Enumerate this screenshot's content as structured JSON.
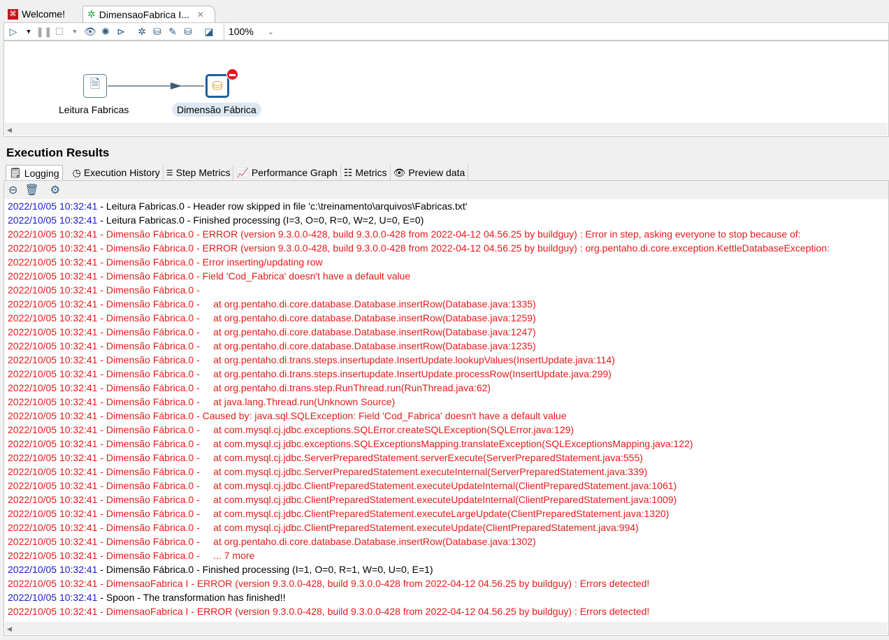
{
  "tabs": [
    {
      "label": "Welcome!",
      "icon": "welcome-icon"
    },
    {
      "label": "DimensaoFabrica I...",
      "icon": "transformation-icon"
    }
  ],
  "toolbar": {
    "zoom": "100%"
  },
  "canvas": {
    "steps": [
      {
        "label": "Leitura Fabricas",
        "icon": "text-file-input-icon"
      },
      {
        "label": "Dimensão Fábrica",
        "icon": "insert-update-icon",
        "error": true
      }
    ]
  },
  "results": {
    "title": "Execution Results",
    "tabs": [
      "Logging",
      "Execution History",
      "Step Metrics",
      "Performance Graph",
      "Metrics",
      "Preview data"
    ]
  },
  "colors": {
    "timestamp": "#1a1acc",
    "error": "#e51a1a"
  },
  "log": [
    {
      "ts": "2022/10/05 10:32:41",
      "msg": " - Leitura Fabricas.0 - Header row skipped in file 'c:\\treinamento\\arquivos\\Fabricas.txt'",
      "level": "info"
    },
    {
      "ts": "2022/10/05 10:32:41",
      "msg": " - Leitura Fabricas.0 - Finished processing (I=3, O=0, R=0, W=2, U=0, E=0)",
      "level": "info"
    },
    {
      "ts": "2022/10/05 10:32:41",
      "msg": " - Dimensão Fábrica.0 - ERROR (version 9.3.0.0-428, build 9.3.0.0-428 from 2022-04-12 04.56.25 by buildguy) : Error in step, asking everyone to stop because of:",
      "level": "error"
    },
    {
      "ts": "2022/10/05 10:32:41",
      "msg": " - Dimensão Fábrica.0 - ERROR (version 9.3.0.0-428, build 9.3.0.0-428 from 2022-04-12 04.56.25 by buildguy) : org.pentaho.di.core.exception.KettleDatabaseException:",
      "level": "error"
    },
    {
      "ts": "2022/10/05 10:32:41",
      "msg": " - Dimensão Fábrica.0 - Error inserting/updating row",
      "level": "error"
    },
    {
      "ts": "2022/10/05 10:32:41",
      "msg": " - Dimensão Fábrica.0 - Field 'Cod_Fabrica' doesn't have a default value",
      "level": "error"
    },
    {
      "ts": "2022/10/05 10:32:41",
      "msg": " - Dimensão Fábrica.0 - ",
      "level": "error"
    },
    {
      "ts": "2022/10/05 10:32:41",
      "msg": " - Dimensão Fábrica.0 -     at org.pentaho.di.core.database.Database.insertRow(Database.java:1335)",
      "level": "error"
    },
    {
      "ts": "2022/10/05 10:32:41",
      "msg": " - Dimensão Fábrica.0 -     at org.pentaho.di.core.database.Database.insertRow(Database.java:1259)",
      "level": "error"
    },
    {
      "ts": "2022/10/05 10:32:41",
      "msg": " - Dimensão Fábrica.0 -     at org.pentaho.di.core.database.Database.insertRow(Database.java:1247)",
      "level": "error"
    },
    {
      "ts": "2022/10/05 10:32:41",
      "msg": " - Dimensão Fábrica.0 -     at org.pentaho.di.core.database.Database.insertRow(Database.java:1235)",
      "level": "error"
    },
    {
      "ts": "2022/10/05 10:32:41",
      "msg": " - Dimensão Fábrica.0 -     at org.pentaho.di.trans.steps.insertupdate.InsertUpdate.lookupValues(InsertUpdate.java:114)",
      "level": "error"
    },
    {
      "ts": "2022/10/05 10:32:41",
      "msg": " - Dimensão Fábrica.0 -     at org.pentaho.di.trans.steps.insertupdate.InsertUpdate.processRow(InsertUpdate.java:299)",
      "level": "error"
    },
    {
      "ts": "2022/10/05 10:32:41",
      "msg": " - Dimensão Fábrica.0 -     at org.pentaho.di.trans.step.RunThread.run(RunThread.java:62)",
      "level": "error"
    },
    {
      "ts": "2022/10/05 10:32:41",
      "msg": " - Dimensão Fábrica.0 -     at java.lang.Thread.run(Unknown Source)",
      "level": "error"
    },
    {
      "ts": "2022/10/05 10:32:41",
      "msg": " - Dimensão Fábrica.0 - Caused by: java.sql.SQLException: Field 'Cod_Fabrica' doesn't have a default value",
      "level": "error"
    },
    {
      "ts": "2022/10/05 10:32:41",
      "msg": " - Dimensão Fábrica.0 -     at com.mysql.cj.jdbc.exceptions.SQLError.createSQLException(SQLError.java:129)",
      "level": "error"
    },
    {
      "ts": "2022/10/05 10:32:41",
      "msg": " - Dimensão Fábrica.0 -     at com.mysql.cj.jdbc.exceptions.SQLExceptionsMapping.translateException(SQLExceptionsMapping.java:122)",
      "level": "error"
    },
    {
      "ts": "2022/10/05 10:32:41",
      "msg": " - Dimensão Fábrica.0 -     at com.mysql.cj.jdbc.ServerPreparedStatement.serverExecute(ServerPreparedStatement.java:555)",
      "level": "error"
    },
    {
      "ts": "2022/10/05 10:32:41",
      "msg": " - Dimensão Fábrica.0 -     at com.mysql.cj.jdbc.ServerPreparedStatement.executeInternal(ServerPreparedStatement.java:339)",
      "level": "error"
    },
    {
      "ts": "2022/10/05 10:32:41",
      "msg": " - Dimensão Fábrica.0 -     at com.mysql.cj.jdbc.ClientPreparedStatement.executeUpdateInternal(ClientPreparedStatement.java:1061)",
      "level": "error"
    },
    {
      "ts": "2022/10/05 10:32:41",
      "msg": " - Dimensão Fábrica.0 -     at com.mysql.cj.jdbc.ClientPreparedStatement.executeUpdateInternal(ClientPreparedStatement.java:1009)",
      "level": "error"
    },
    {
      "ts": "2022/10/05 10:32:41",
      "msg": " - Dimensão Fábrica.0 -     at com.mysql.cj.jdbc.ClientPreparedStatement.executeLargeUpdate(ClientPreparedStatement.java:1320)",
      "level": "error"
    },
    {
      "ts": "2022/10/05 10:32:41",
      "msg": " - Dimensão Fábrica.0 -     at com.mysql.cj.jdbc.ClientPreparedStatement.executeUpdate(ClientPreparedStatement.java:994)",
      "level": "error"
    },
    {
      "ts": "2022/10/05 10:32:41",
      "msg": " - Dimensão Fábrica.0 -     at org.pentaho.di.core.database.Database.insertRow(Database.java:1302)",
      "level": "error"
    },
    {
      "ts": "2022/10/05 10:32:41",
      "msg": " - Dimensão Fábrica.0 -     ... 7 more",
      "level": "error"
    },
    {
      "ts": "2022/10/05 10:32:41",
      "msg": " - Dimensão Fábrica.0 - Finished processing (I=1, O=0, R=1, W=0, U=0, E=1)",
      "level": "info"
    },
    {
      "ts": "2022/10/05 10:32:41",
      "msg": " - DimensaoFabrica I - ERROR (version 9.3.0.0-428, build 9.3.0.0-428 from 2022-04-12 04.56.25 by buildguy) : Errors detected!",
      "level": "error"
    },
    {
      "ts": "2022/10/05 10:32:41",
      "msg": " - Spoon - The transformation has finished!!",
      "level": "info"
    },
    {
      "ts": "2022/10/05 10:32:41",
      "msg": " - DimensaoFabrica I - ERROR (version 9.3.0.0-428, build 9.3.0.0-428 from 2022-04-12 04.56.25 by buildguy) : Errors detected!",
      "level": "error"
    }
  ]
}
